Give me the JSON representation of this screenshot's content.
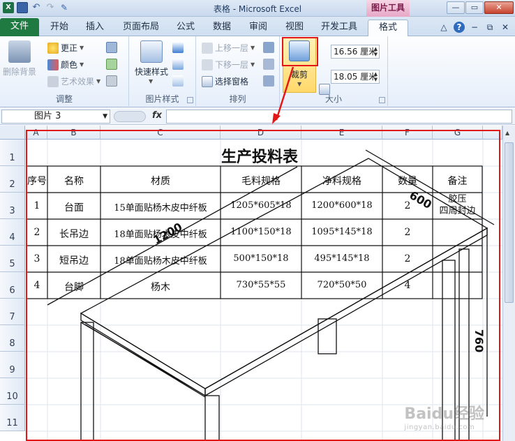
{
  "window": {
    "title": "表格 - Microsoft Excel",
    "context_tab": "图片工具",
    "buttons": {
      "minimize": "—",
      "restore": "▭",
      "close": "✕"
    }
  },
  "qat": {
    "excel_logo": "X"
  },
  "tabs": [
    {
      "label": "文件"
    },
    {
      "label": "开始"
    },
    {
      "label": "插入"
    },
    {
      "label": "页面布局"
    },
    {
      "label": "公式"
    },
    {
      "label": "数据"
    },
    {
      "label": "审阅"
    },
    {
      "label": "视图"
    },
    {
      "label": "开发工具"
    },
    {
      "label": "格式",
      "active": true
    }
  ],
  "ribbon": {
    "adjust": {
      "label": "调整",
      "remove_bg": "删除背景",
      "corrections": "更正",
      "color": "颜色",
      "art_effects": "艺术效果"
    },
    "picture_styles": {
      "label": "图片样式",
      "quick_styles": "快速样式"
    },
    "arrange": {
      "label": "排列",
      "bring_forward": "上移一层",
      "send_backward": "下移一层",
      "selection_pane": "选择窗格"
    },
    "size": {
      "label": "大小",
      "crop": "裁剪",
      "height": "16.56 厘米",
      "width": "18.05 厘米"
    }
  },
  "formula_bar": {
    "name_box": "图片 3",
    "fx": "fx",
    "formula": ""
  },
  "sheet": {
    "columns": [
      "A",
      "B",
      "C",
      "D",
      "E",
      "F",
      "G"
    ],
    "rows": [
      "1",
      "2",
      "3",
      "4",
      "5",
      "6",
      "7",
      "8",
      "9",
      "10",
      "11"
    ]
  },
  "picture": {
    "title": "生产投料表",
    "headers": [
      "序号",
      "名称",
      "材质",
      "毛料规格",
      "净料规格",
      "数量",
      "备注"
    ],
    "rows": [
      [
        "1",
        "台面",
        "15单面贴杨木皮中纤板",
        "1205*605*18",
        "1200*600*18",
        "2",
        "胶压\n四周封边"
      ],
      [
        "2",
        "长吊边",
        "18单面贴杨木皮中纤板",
        "1100*150*18",
        "1095*145*18",
        "2",
        ""
      ],
      [
        "3",
        "短吊边",
        "18单面贴杨木皮中纤板",
        "500*150*18",
        "495*145*18",
        "2",
        ""
      ],
      [
        "4",
        "台脚",
        "杨木",
        "730*55*55",
        "720*50*50",
        "4",
        ""
      ]
    ],
    "dims": {
      "length": "1200",
      "depth": "600",
      "height": "760"
    },
    "watermark": "Baidu经验",
    "watermark_sub": "jingyan.baidu.com"
  },
  "colors": {
    "highlight": "#e21818",
    "file_tab": "#1f7a42"
  }
}
